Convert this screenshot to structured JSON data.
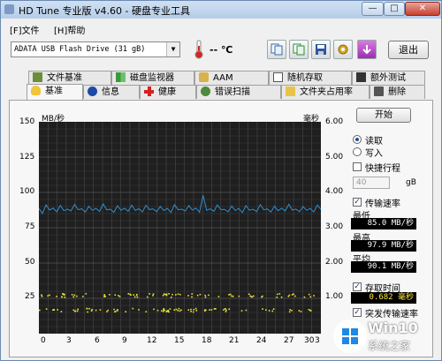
{
  "window": {
    "title": "HD Tune 专业版 v4.60 - 硬盘专业工具",
    "min_label": "—",
    "max_label": "□",
    "close_label": "✕"
  },
  "menu": [
    "[F]文件",
    "[H]帮助"
  ],
  "toolbar": {
    "drive": "ADATA   USB Flash Drive   (31 gB)",
    "temperature": "-- ℃",
    "exit_label": "退出"
  },
  "tabs_top": [
    "文件基准",
    "磁盘监视器",
    "AAM",
    "随机存取",
    "额外测试"
  ],
  "tabs_bottom": [
    "基准",
    "信息",
    "健康",
    "错误扫描",
    "文件夹占用率",
    "删除"
  ],
  "chart": {
    "left_unit": "MB/秒",
    "right_unit": "毫秒",
    "left_ticks": [
      "150",
      "125",
      "100",
      "75",
      "50",
      "25"
    ],
    "right_ticks": [
      "6.00",
      "5.00",
      "4.00",
      "3.00",
      "2.00",
      "1.00"
    ],
    "x_ticks": [
      "0",
      "3",
      "6",
      "9",
      "12",
      "15",
      "18",
      "21",
      "24",
      "27",
      "30",
      "3"
    ]
  },
  "chart_data": {
    "type": "line",
    "series": [
      {
        "y_axis": "left",
        "color": "#2f8fd0",
        "values": [
          88.6,
          85.1,
          91.2,
          87.5,
          88.9,
          86.3,
          90.8,
          87.0,
          88.2,
          86.9,
          91.5,
          87.8,
          88.4,
          86.1,
          90.2,
          87.3,
          88.7,
          86.5,
          91.8,
          87.6,
          88.1,
          85.9,
          90.5,
          87.4,
          88.8,
          86.7,
          91.0,
          87.2,
          88.5,
          86.2,
          90.9,
          87.9,
          88.3,
          86.4,
          90.1,
          87.1,
          88.6,
          85.8,
          91.3,
          87.7,
          88.2,
          86.8,
          90.7,
          87.5,
          88.9,
          86.0,
          97.9,
          87.3,
          88.4,
          86.6,
          91.1,
          87.8,
          88.0,
          86.3,
          90.4,
          87.2,
          88.7,
          85.7,
          90.6,
          87.4,
          88.1,
          86.5,
          91.4,
          87.6,
          88.3,
          86.1,
          90.3,
          87.0,
          88.8,
          86.9,
          91.6,
          87.5,
          88.2,
          86.4,
          90.0,
          87.3,
          88.6,
          86.2,
          91.0,
          88.0
        ]
      },
      {
        "y_axis": "right",
        "color": "#e8e23c",
        "values": [
          0.682,
          1.1
        ]
      }
    ],
    "xlim": [
      0,
      31
    ],
    "ylim_left": [
      0,
      150
    ],
    "ylim_right": [
      0,
      6
    ],
    "grid": true
  },
  "side": {
    "start_label": "开始",
    "read_label": "读取",
    "write_label": "写入",
    "quick_label": "快捷行程",
    "quick_value": "40",
    "quick_unit": "gB",
    "transfer_label": "传输速率",
    "min_label": "最低",
    "min_value": "85.0 MB/秒",
    "max_label": "最高",
    "max_value": "97.9 MB/秒",
    "avg_label": "平均",
    "avg_value": "90.1 MB/秒",
    "access_label": "存取时间",
    "access_value": "0.682 毫秒",
    "burst_label": "突发传输速率"
  },
  "watermark": {
    "brand": "Win10",
    "sub": "系统之家"
  }
}
